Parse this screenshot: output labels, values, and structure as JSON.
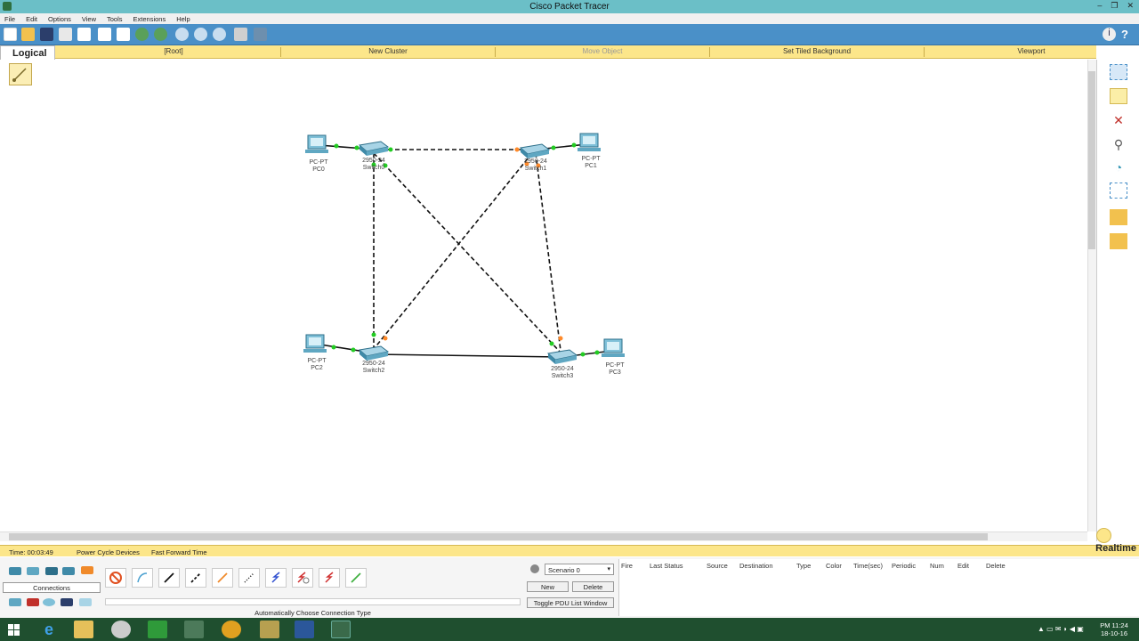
{
  "window": {
    "title": "Cisco Packet Tracer",
    "buttons": [
      "–",
      "❐",
      "✕"
    ]
  },
  "menu": [
    "File",
    "Edit",
    "Options",
    "View",
    "Tools",
    "Extensions",
    "Help"
  ],
  "workspace_bar": {
    "tab": "Logical",
    "items": [
      "[Root]",
      "New Cluster",
      "Move Object",
      "Set Tiled Background",
      "Viewport"
    ]
  },
  "devices": [
    {
      "id": "pc0",
      "type": "PC-PT",
      "name": "PC0"
    },
    {
      "id": "pc1",
      "type": "PC-PT",
      "name": "PC1"
    },
    {
      "id": "pc2",
      "type": "PC-PT",
      "name": "PC2"
    },
    {
      "id": "pc3",
      "type": "PC-PT",
      "name": "PC3"
    },
    {
      "id": "sw0",
      "type": "2950-24",
      "name": "Switch0"
    },
    {
      "id": "sw1",
      "type": "2950-24",
      "name": "Switch1"
    },
    {
      "id": "sw2",
      "type": "2950-24",
      "name": "Switch2"
    },
    {
      "id": "sw3",
      "type": "2950-24",
      "name": "Switch3"
    }
  ],
  "status": {
    "time": "Time: 00:03:49",
    "power_cycle": "Power Cycle Devices",
    "fast_forward": "Fast Forward Time",
    "mode": "Realtime"
  },
  "bottom": {
    "category_label": "Connections",
    "connection_hint": "Automatically Choose Connection Type",
    "scenario": "Scenario 0",
    "new_label": "New",
    "delete_label": "Delete",
    "toggle_label": "Toggle PDU List Window",
    "pdu_columns": [
      "Fire",
      "Last Status",
      "Source",
      "Destination",
      "Type",
      "Color",
      "Time(sec)",
      "Periodic",
      "Num",
      "Edit",
      "Delete"
    ]
  },
  "taskbar": {
    "time": "PM 11:24",
    "date": "18-10-16"
  },
  "colors": {
    "titlebar": "#6bbfc7",
    "toolbar": "#4a90c8",
    "workspace_bar": "#fce68a",
    "link_up": "#22cc22",
    "link_pending": "#ff8a2a"
  }
}
